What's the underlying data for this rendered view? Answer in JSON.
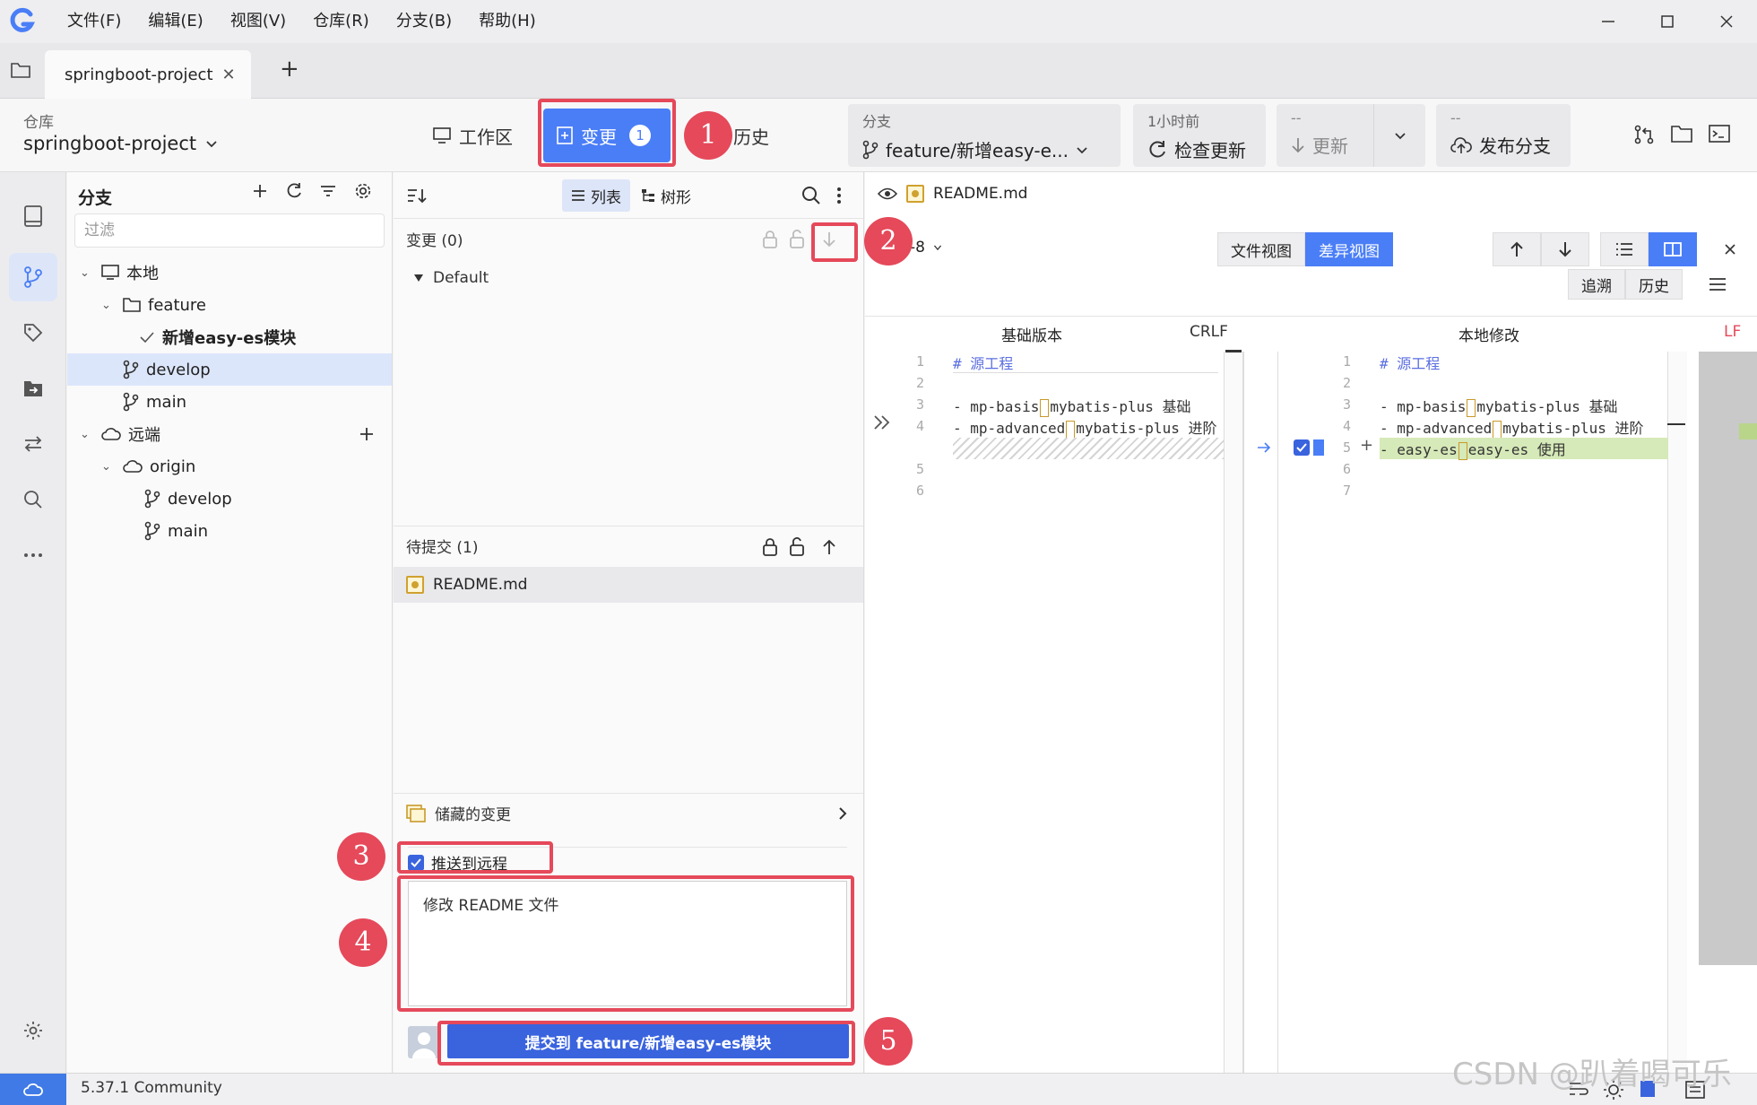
{
  "menu": [
    "文件(F)",
    "编辑(E)",
    "视图(V)",
    "仓库(R)",
    "分支(B)",
    "帮助(H)"
  ],
  "tab": {
    "name": "springboot-project",
    "close": "✕",
    "add": "+"
  },
  "toolbar": {
    "repo_label": "仓库",
    "repo_name": "springboot-project",
    "workspace": "工作区",
    "changes": "变更",
    "changes_count": "1",
    "history": "历史",
    "branch_label": "分支",
    "branch_value": "feature/新增easy-e...",
    "fetch_time": "1小时前",
    "fetch_label": "检查更新",
    "update_small": "--",
    "update_label": "更新",
    "publish_small": "--",
    "publish_label": "发布分支"
  },
  "annotations": [
    "1",
    "2",
    "3",
    "4",
    "5"
  ],
  "branches": {
    "title": "分支",
    "filter_placeholder": "过滤",
    "local": "本地",
    "feature_folder": "feature",
    "feature_branch": "新增easy-es模块",
    "develop": "develop",
    "main": "main",
    "remote": "远端",
    "origin": "origin",
    "remote_develop": "develop",
    "remote_main": "main"
  },
  "changes": {
    "view_list": "列表",
    "view_tree": "树形",
    "unstaged_title": "变更 (0)",
    "default_group": "Default",
    "staged_title": "待提交 (1)",
    "staged_file": "README.md",
    "stash": "储藏的变更",
    "push_label": "推送到远程",
    "commit_message": "修改 README 文件",
    "commit_button": "提交到 feature/新增easy-es模块"
  },
  "diff": {
    "file": "README.md",
    "encoding_frag": "-8",
    "file_view": "文件视图",
    "diff_view": "差异视图",
    "blame": "追溯",
    "history": "历史",
    "left_title": "基础版本",
    "left_eol": "CRLF",
    "right_title": "本地修改",
    "right_eol": "LF",
    "left_lines": [
      {
        "n": "1",
        "a": "# 源工程",
        "b": ""
      },
      {
        "n": "2",
        "a": "",
        "b": ""
      },
      {
        "n": "3",
        "a": "- mp-basis",
        "b": "mybatis-plus 基础"
      },
      {
        "n": "4",
        "a": "- mp-advanced",
        "b": "mybatis-plus 进阶"
      },
      {
        "n": "5",
        "a": "",
        "b": ""
      },
      {
        "n": "6",
        "a": "",
        "b": ""
      }
    ],
    "right_lines": [
      {
        "n": "1",
        "a": "# 源工程",
        "b": ""
      },
      {
        "n": "2",
        "a": "",
        "b": ""
      },
      {
        "n": "3",
        "a": "- mp-basis",
        "b": "mybatis-plus 基础"
      },
      {
        "n": "4",
        "a": "- mp-advanced",
        "b": "mybatis-plus 进阶"
      },
      {
        "n": "5",
        "a": "- easy-es",
        "b": "easy-es 使用"
      },
      {
        "n": "6",
        "a": "",
        "b": ""
      },
      {
        "n": "7",
        "a": "",
        "b": ""
      }
    ]
  },
  "status": {
    "version": "5.37.1 Community"
  },
  "watermark": "CSDN @趴着喝可乐"
}
